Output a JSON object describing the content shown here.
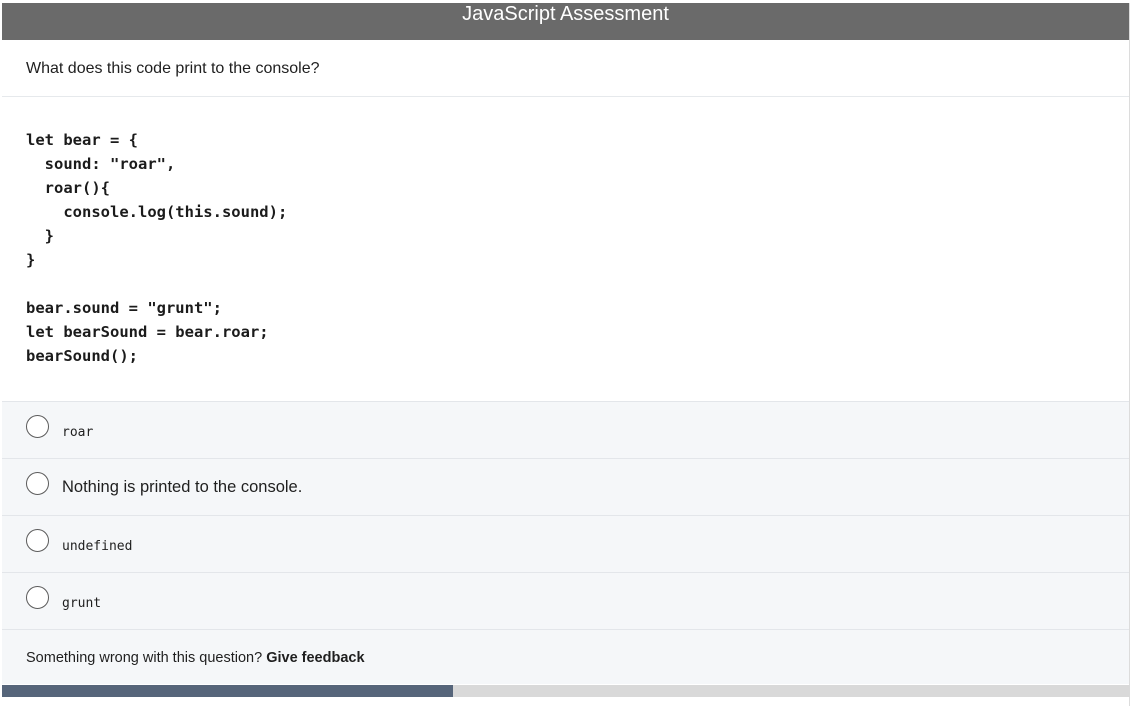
{
  "header": {
    "title": "JavaScript Assessment"
  },
  "question": {
    "prompt": "What does this code print to the console?",
    "code": "let bear = {\n  sound: \"roar\",\n  roar(){\n    console.log(this.sound);\n  }\n}\n\nbear.sound = \"grunt\";\nlet bearSound = bear.roar;\nbearSound();"
  },
  "options": [
    {
      "label": "roar",
      "style": "mono",
      "selected": false
    },
    {
      "label": "Nothing is printed to the console.",
      "style": "sans",
      "selected": false
    },
    {
      "label": "undefined",
      "style": "mono",
      "selected": false
    },
    {
      "label": "grunt",
      "style": "mono",
      "selected": false
    }
  ],
  "feedback": {
    "text": "Something wrong with this question?",
    "link": "Give feedback"
  },
  "progress": {
    "fraction": 0.4
  },
  "colors": {
    "header_bg": "#6a6a6a",
    "options_bg": "#f5f7f9",
    "progress_fill": "#56657a",
    "progress_track": "#d9d9d9"
  }
}
